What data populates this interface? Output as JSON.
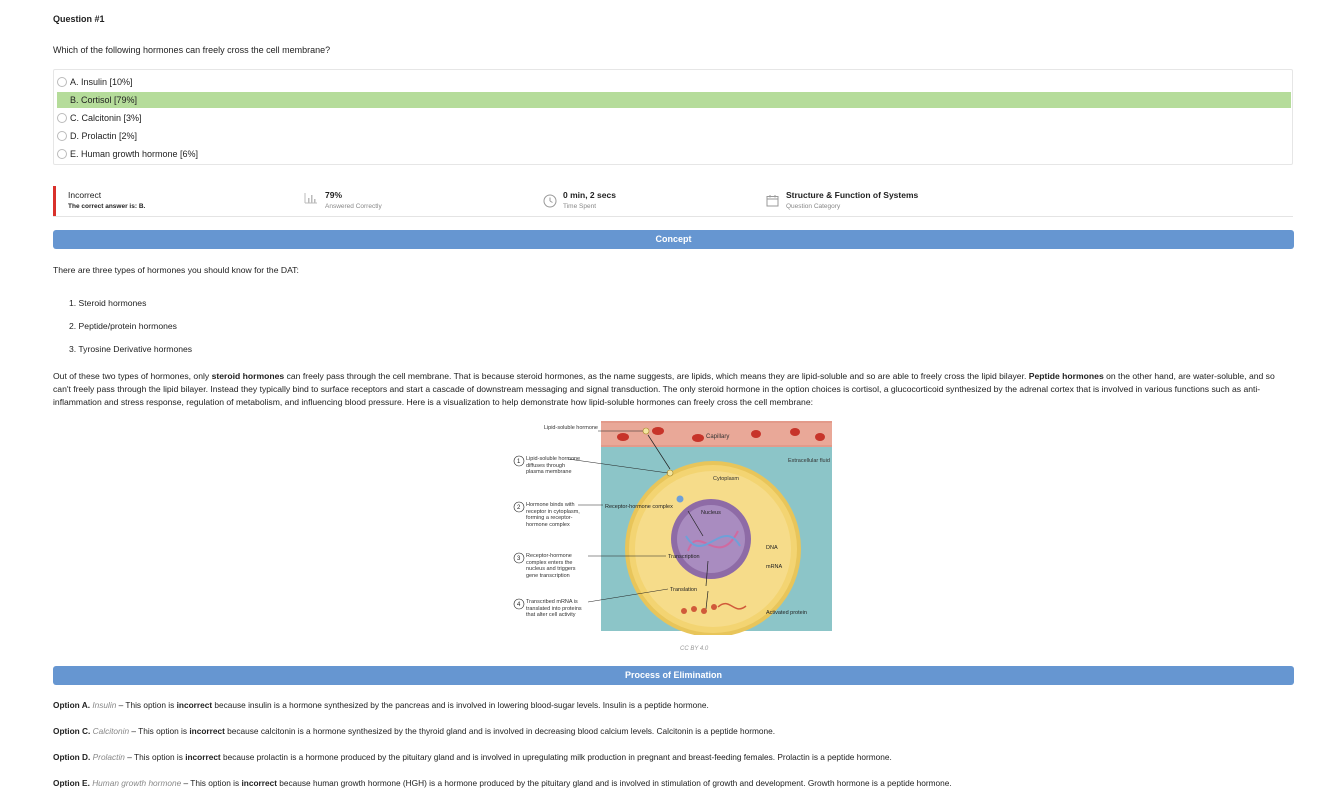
{
  "question": {
    "number_label": "Question #1",
    "text": "Which of the following hormones can freely cross the cell membrane?",
    "options": [
      {
        "label": "A. Insulin [10%]",
        "correct": false
      },
      {
        "label": "B. Cortisol [79%]",
        "correct": true
      },
      {
        "label": "C. Calcitonin [3%]",
        "correct": false
      },
      {
        "label": "D. Prolactin [2%]",
        "correct": false
      },
      {
        "label": "E. Human growth hormone [6%]",
        "correct": false
      }
    ]
  },
  "stats": {
    "result": "Incorrect",
    "correct_answer_prefix": "The correct answer is: ",
    "correct_answer": "B.",
    "percent": "79%",
    "percent_label": "Answered Correctly",
    "time": "0 min, 2 secs",
    "time_label": "Time Spent",
    "category": "Structure & Function of Systems",
    "category_label": "Question Category"
  },
  "concept": {
    "heading": "Concept",
    "intro": "There are three types of hormones you should know for the DAT:",
    "list": [
      "1. Steroid hormones",
      "2. Peptide/protein hormones",
      "3. Tyrosine Derivative hormones"
    ],
    "body_1": "Out of these two types of hormones, only ",
    "body_bold_1": "steroid hormones",
    "body_2": " can freely pass through the cell membrane. That is because steroid hormones, as the name suggests, are lipids, which means they are lipid-soluble and so are able to freely cross the lipid bilayer. ",
    "body_bold_2": "Peptide hormones",
    "body_3": " on the other hand, are water-soluble, and so can't freely pass through the lipid bilayer. Instead they typically bind to surface receptors and start a cascade of downstream messaging and signal transduction. The only steroid hormone in the option choices is cortisol, a glucocorticoid synthesized by the adrenal cortex that is involved in various functions such as anti-inflammation and stress response, regulation of metabolism, and influencing blood pressure. Here is a visualization to help demonstrate how lipid-soluble hormones can freely cross the cell membrane:",
    "figure": {
      "lipid_soluble": "Lipid-soluble hormone",
      "capillary": "Capillary",
      "extracellular": "Extracellular fluid",
      "cytoplasm": "Cytoplasm",
      "nucleus": "Nucleus",
      "receptor_complex": "Receptor-hormone complex",
      "transcription": "Transcription",
      "translation": "Translation",
      "dna": "DNA",
      "mrna": "mRNA",
      "activated": "Activated protein",
      "step1": "Lipid-soluble hormone diffuses through plasma membrane",
      "step2": "Hormone binds with receptor in cytoplasm, forming a receptor-hormone complex",
      "step3": "Receptor-hormone complex enters the nucleus and triggers gene transcription",
      "step4": "Transcribed mRNA is translated into proteins that alter cell activity",
      "num1": "1",
      "num2": "2",
      "num3": "3",
      "num4": "4"
    },
    "credit": "CC BY 4.0"
  },
  "elimination": {
    "heading": "Process of Elimination",
    "items": [
      {
        "option": "Option A.",
        "name": "Insulin",
        "pre": " – This option is ",
        "verdict": "incorrect",
        "post": " because insulin is a hormone synthesized by the pancreas and is involved in lowering blood-sugar levels. Insulin is a peptide hormone."
      },
      {
        "option": "Option C.",
        "name": "Calcitonin",
        "pre": " – This option is ",
        "verdict": "incorrect",
        "post": " because calcitonin is a hormone synthesized by the thyroid gland and is involved in decreasing blood calcium levels. Calcitonin is a peptide hormone."
      },
      {
        "option": "Option D.",
        "name": "Prolactin",
        "pre": " – This option is ",
        "verdict": "incorrect",
        "post": " because prolactin is a hormone produced by the pituitary gland and is involved in upregulating milk production in pregnant and breast-feeding females. Prolactin is a peptide hormone."
      },
      {
        "option": "Option E.",
        "name": "Human growth hormone",
        "pre": " – This option is ",
        "verdict": "incorrect",
        "post": " because human growth hormone (HGH) is a hormone produced by the pituitary gland and is involved in stimulation of growth and development. Growth hormone is a peptide hormone."
      }
    ]
  },
  "colors": {
    "accent": "#6696d1",
    "correct_bg": "#b5dc9a",
    "incorrect": "#d9312b"
  },
  "icons": [
    "bar-chart-icon",
    "clock-icon",
    "calendar-icon"
  ]
}
